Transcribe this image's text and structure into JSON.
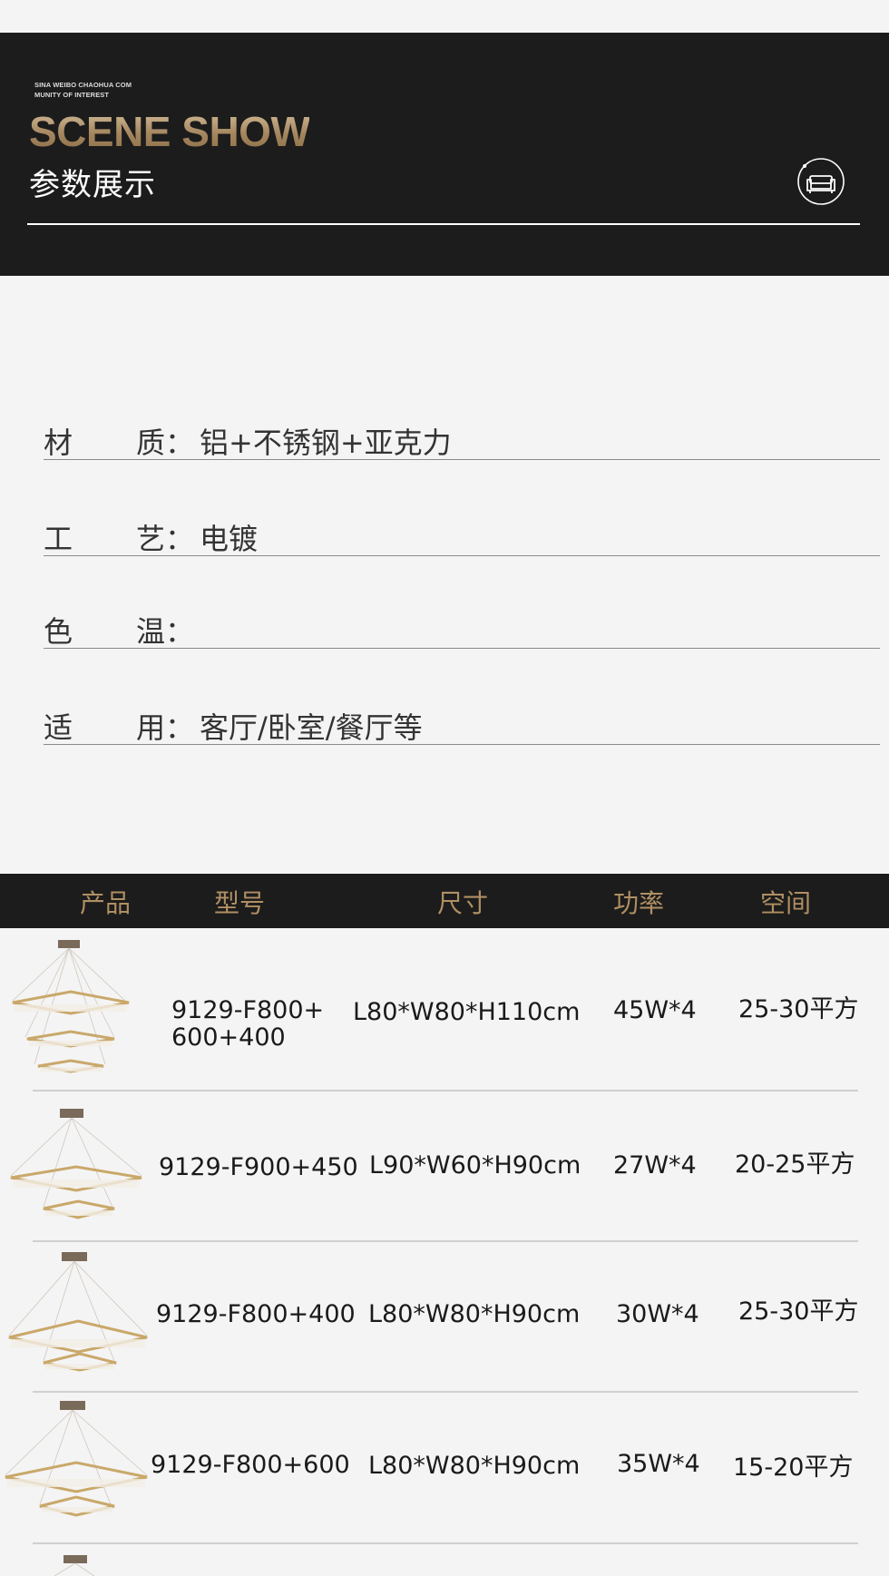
{
  "header": {
    "small_en_line1": "SINA WEIBO CHAOHUA COM",
    "small_en_line2": "MUNITY OF INTEREST",
    "title_en": "SCENE  SHOW",
    "title_cn": "参数展示",
    "icon": "sofa-icon",
    "accent_color": "#a4865e"
  },
  "specs": [
    {
      "c1": "材",
      "c2": "质：",
      "value": "铝+不锈钢+亚克力"
    },
    {
      "c1": "工",
      "c2": "艺：",
      "value": "电镀"
    },
    {
      "c1": "色",
      "c2": "温：",
      "value": ""
    },
    {
      "c1": "适",
      "c2": "用：",
      "value": "客厅/卧室/餐厅等"
    }
  ],
  "table": {
    "headers": [
      "产品",
      "型号",
      "尺寸",
      "功率",
      "空间"
    ],
    "rows": [
      {
        "image": "chandelier-3-tier-square",
        "model_line1": "9129-F800+",
        "model_line2": "600+400",
        "size": "L80*W80*H110cm",
        "power": "45W*4",
        "space": "25-30平方"
      },
      {
        "image": "chandelier-2-tier-rect",
        "model_line1": "9129-F900+450",
        "model_line2": "",
        "size": "L90*W60*H90cm",
        "power": "27W*4",
        "space": "20-25平方"
      },
      {
        "image": "chandelier-2-tier-square",
        "model_line1": "9129-F800+400",
        "model_line2": "",
        "size": "L80*W80*H90cm",
        "power": "30W*4",
        "space": "25-30平方"
      },
      {
        "image": "chandelier-2-tier-square",
        "model_line1": "9129-F800+600",
        "model_line2": "",
        "size": "L80*W80*H90cm",
        "power": "35W*4",
        "space": "15-20平方"
      }
    ]
  }
}
